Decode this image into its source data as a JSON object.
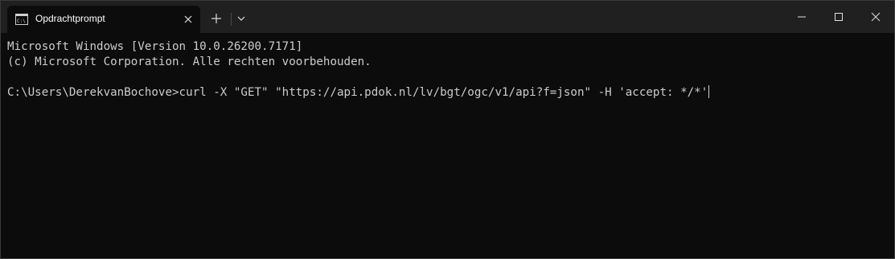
{
  "window": {
    "tab_title": "Opdrachtprompt",
    "icons": {
      "tab_icon": "cmd-icon",
      "tab_close": "close-icon",
      "new_tab": "plus-icon",
      "dropdown": "chevron-down-icon",
      "minimize": "minimize-icon",
      "maximize": "maximize-icon",
      "close": "close-icon"
    }
  },
  "terminal": {
    "lines": [
      "Microsoft Windows [Version 10.0.26200.7171]",
      "(c) Microsoft Corporation. Alle rechten voorbehouden.",
      "",
      "C:\\Users\\DerekvanBochove>curl -X \"GET\" \"https://api.pdok.nl/lv/bgt/ogc/v1/api?f=json\" -H 'accept: */*'"
    ]
  },
  "colors": {
    "background": "#0c0c0c",
    "tabbar": "#202020",
    "text": "#cccccc"
  }
}
